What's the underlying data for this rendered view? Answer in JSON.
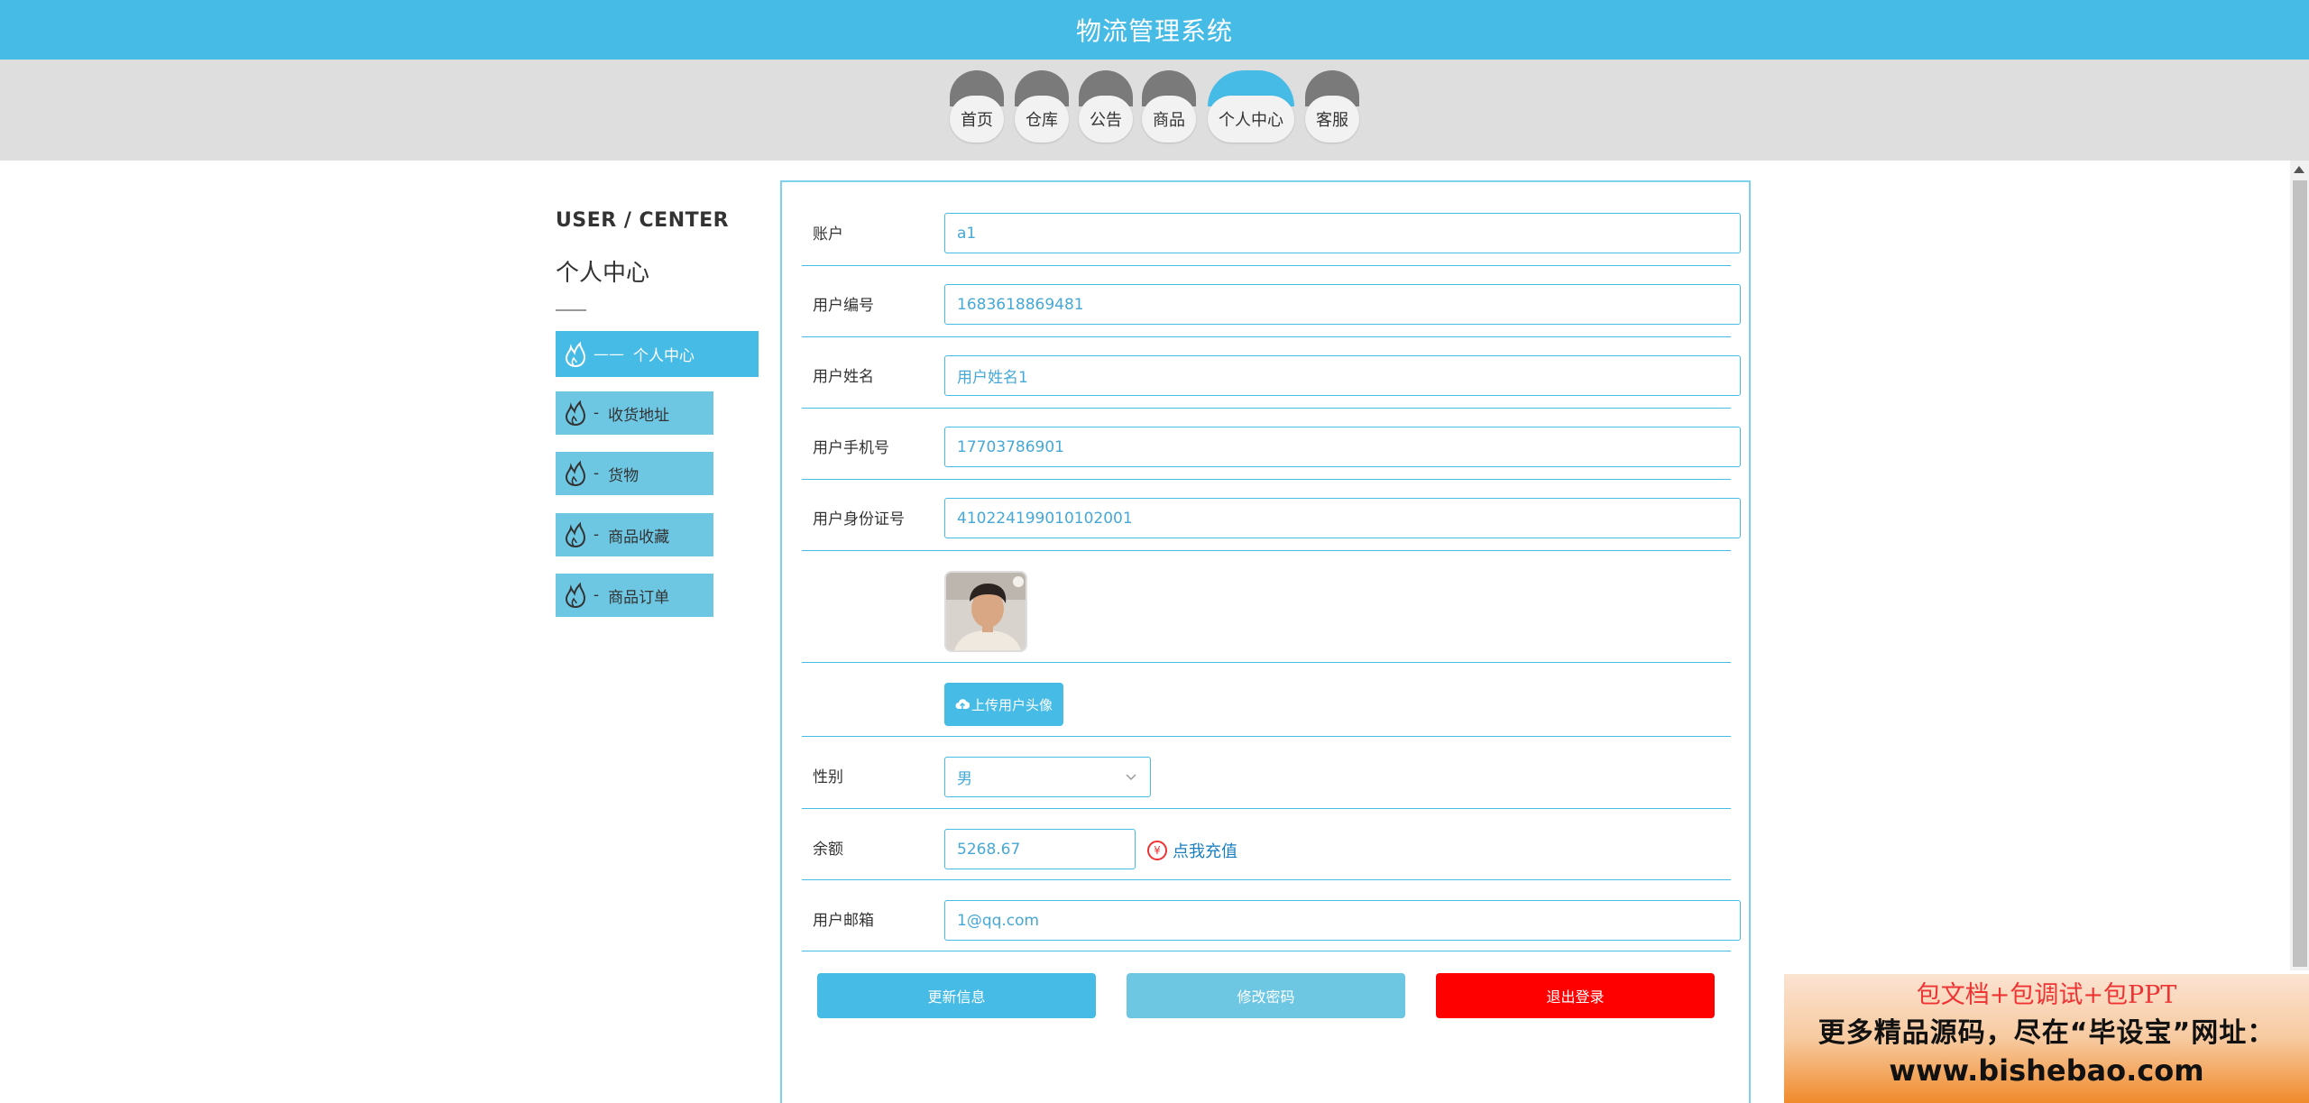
{
  "app": {
    "title": "物流管理系统"
  },
  "nav": {
    "items": [
      {
        "label": "首页"
      },
      {
        "label": "仓库"
      },
      {
        "label": "公告"
      },
      {
        "label": "商品"
      },
      {
        "label": "个人中心",
        "active": true
      },
      {
        "label": "客服"
      }
    ]
  },
  "sidebar": {
    "title_en": "USER / CENTER",
    "title_cn": "个人中心",
    "items": [
      {
        "label": "个人中心",
        "prefix": "——",
        "active": true
      },
      {
        "label": "收货地址",
        "prefix": "-"
      },
      {
        "label": "货物",
        "prefix": "-"
      },
      {
        "label": "商品收藏",
        "prefix": "-"
      },
      {
        "label": "商品订单",
        "prefix": "-"
      }
    ]
  },
  "form": {
    "account_label": "账户",
    "account_value": "a1",
    "user_no_label": "用户编号",
    "user_no_value": "1683618869481",
    "user_name_label": "用户姓名",
    "user_name_value": "用户姓名1",
    "phone_label": "用户手机号",
    "phone_value": "17703786901",
    "id_card_label": "用户身份证号",
    "id_card_value": "410224199010102001",
    "upload_label": "上传用户头像",
    "gender_label": "性别",
    "gender_value": "男",
    "balance_label": "余额",
    "balance_value": "5268.67",
    "recharge_icon": "¥",
    "recharge_label": "点我充值",
    "email_label": "用户邮箱",
    "email_value": "1@qq.com"
  },
  "buttons": {
    "update": "更新信息",
    "change_password": "修改密码",
    "logout": "退出登录"
  },
  "colors": {
    "primary": "#46bbe6",
    "menu": "#6dc7e3",
    "logout": "#ff0000"
  },
  "ad": {
    "line1": "包文档+包调试+包PPT",
    "line2": "更多精品源码，尽在“毕设宝”网址：",
    "line3": "www.bishebao.com"
  }
}
